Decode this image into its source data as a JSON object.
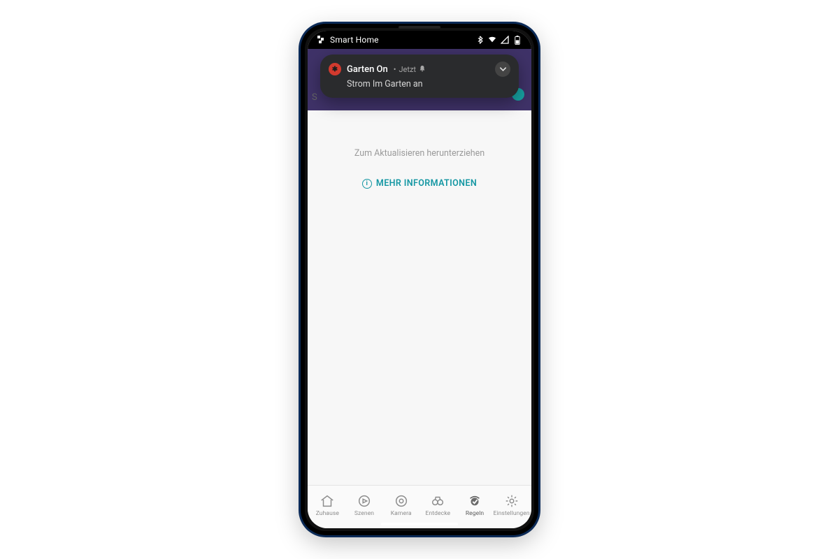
{
  "statusbar": {
    "app_label": "Smart Home"
  },
  "notification": {
    "title": "Garten On",
    "time": "Jetzt",
    "body": "Strom Im Garten an"
  },
  "content": {
    "pull_hint": "Zum Aktualisieren herunterziehen",
    "more_info": "MEHR INFORMATIONEN",
    "hidden_initial": "S"
  },
  "bottom_nav": {
    "items": [
      {
        "label": "Zuhause"
      },
      {
        "label": "Szenen"
      },
      {
        "label": "Kamera"
      },
      {
        "label": "Entdecke"
      },
      {
        "label": "Regeln"
      },
      {
        "label": "Einstellungen"
      }
    ],
    "active_index": 4
  }
}
